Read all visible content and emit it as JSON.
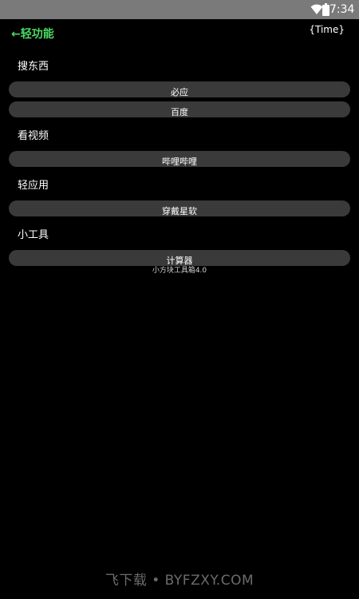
{
  "status_bar": {
    "time": "7:34",
    "icons": [
      "wifi-icon",
      "battery-icon"
    ]
  },
  "header": {
    "back_label": "←轻功能",
    "time_token": "{Time}"
  },
  "sections": [
    {
      "title": "搜东西",
      "items": [
        "必应",
        "百度"
      ]
    },
    {
      "title": "看视频",
      "items": [
        "哔哩哔哩"
      ]
    },
    {
      "title": "轻应用",
      "items": [
        "穿戴星软"
      ]
    },
    {
      "title": "小工具",
      "items": [
        "计算器"
      ]
    }
  ],
  "footer": {
    "version": "小方块工具箱4.0"
  },
  "watermark": "飞下载 • BYFZXY.COM",
  "colors": {
    "background": "#000000",
    "status_bar": "#7a7a7a",
    "accent": "#4cd964",
    "pill": "#3a3a3a",
    "text": "#ffffff"
  }
}
